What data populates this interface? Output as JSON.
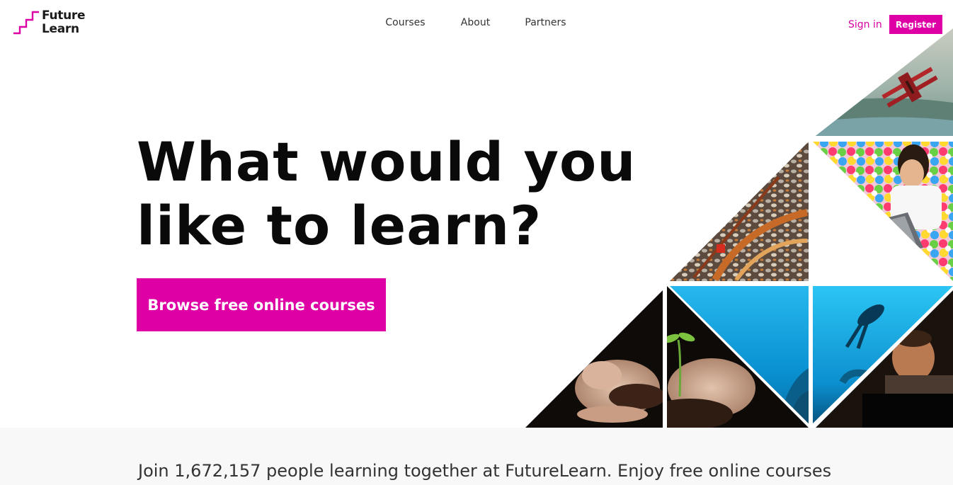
{
  "brand": {
    "line1": "Future",
    "line2": "Learn",
    "color": "#de00a5"
  },
  "nav": [
    {
      "label": "Courses"
    },
    {
      "label": "About"
    },
    {
      "label": "Partners"
    }
  ],
  "account": {
    "signin": "Sign in",
    "register": "Register"
  },
  "hero": {
    "title_line1": "What would you",
    "title_line2": "like to learn?",
    "cta": "Browse free online courses"
  },
  "stats": {
    "text": "Join 1,672,157 people learning together at FutureLearn. Enjoy free online courses"
  },
  "mosaic_images": [
    "biplane-painting",
    "coins-texture",
    "child-laptop-ball-pit",
    "hands-soil",
    "hands-seedling",
    "underwater-reef",
    "scuba-diver",
    "man-at-laptop"
  ]
}
